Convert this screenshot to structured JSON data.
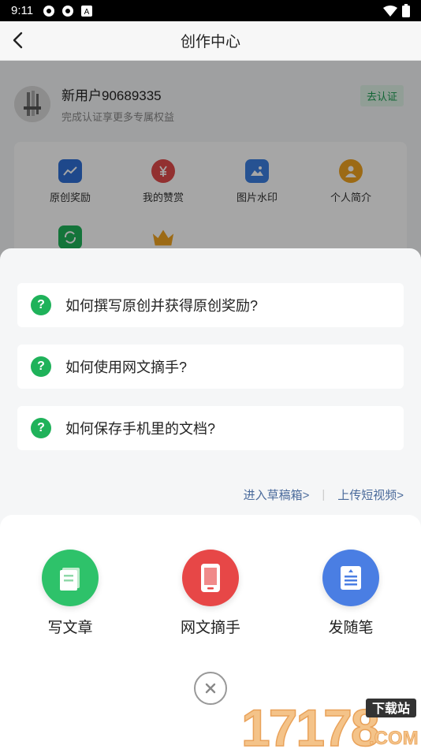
{
  "status_bar": {
    "time": "9:11"
  },
  "header": {
    "title": "创作中心"
  },
  "user": {
    "name": "新用户90689335",
    "subtitle": "完成认证享更多专属权益",
    "verify_label": "去认证"
  },
  "grid": {
    "items": [
      {
        "label": "原创奖励",
        "icon": "chart-icon",
        "color": "#2f6fd6"
      },
      {
        "label": "我的赞赏",
        "icon": "yen-icon",
        "color": "#e04a4a"
      },
      {
        "label": "图片水印",
        "icon": "image-icon",
        "color": "#3b7fe0"
      },
      {
        "label": "个人简介",
        "icon": "person-icon",
        "color": "#f0a321"
      }
    ]
  },
  "faq": {
    "items": [
      {
        "text": "如何撰写原创并获得原创奖励?"
      },
      {
        "text": "如何使用网文摘手?"
      },
      {
        "text": "如何保存手机里的文档?"
      }
    ],
    "qmark": "?"
  },
  "links": {
    "drafts": "进入草稿箱>",
    "separator": "|",
    "upload_video": "上传短视频>"
  },
  "actions": [
    {
      "label": "写文章",
      "icon": "document-icon",
      "color": "#2ec26a"
    },
    {
      "label": "网文摘手",
      "icon": "phone-icon",
      "color": "#e74747"
    },
    {
      "label": "发随笔",
      "icon": "note-icon",
      "color": "#4a7ee3"
    }
  ],
  "watermark": {
    "number": "17178",
    "tag": "下载站",
    "domain": ".COM"
  }
}
